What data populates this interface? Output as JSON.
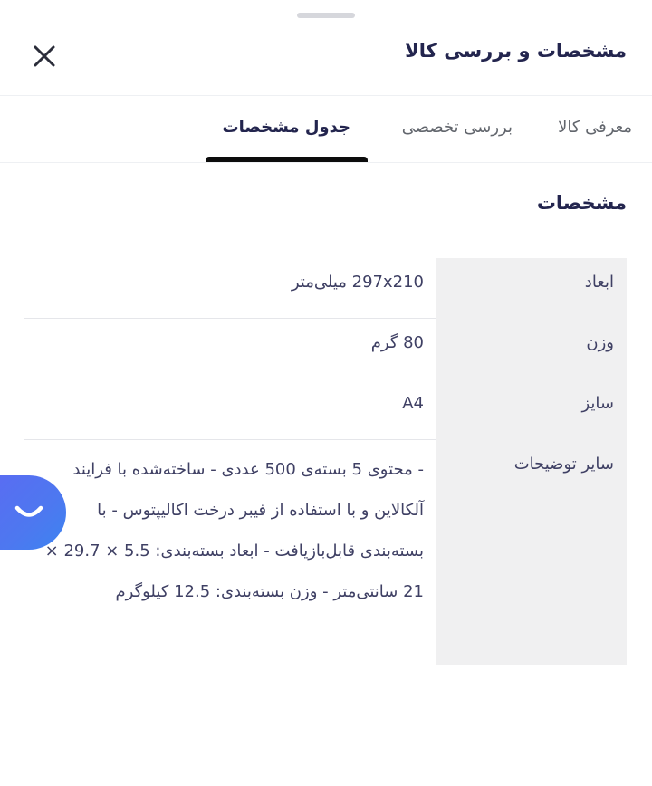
{
  "header": {
    "title": "مشخصات و بررسی کالا"
  },
  "tabs": [
    {
      "label": "معرفی کالا",
      "active": false
    },
    {
      "label": "بررسی تخصصی",
      "active": false
    },
    {
      "label": "جدول مشخصات",
      "active": true
    }
  ],
  "section": {
    "title": "مشخصات"
  },
  "specs": [
    {
      "key": "ابعاد",
      "value": "297x210 میلی‌متر"
    },
    {
      "key": "وزن",
      "value": "80 گرم"
    },
    {
      "key": "سایز",
      "value": "A4"
    },
    {
      "key": "سایر توضیحات",
      "value": "- محتوی 5 بسته‌ی 500 عددی - ساخته‌شده با فرایند آلکالاین و با استفاده از فیبر درخت اکالیپتوس - با بسته‌بندی قابل‌بازیافت - ابعاد بسته‌بندی: 5.5 × 29.7 × 21 سانتی‌متر - وزن بسته‌بندی: 12.5 کیلوگرم"
    }
  ],
  "colors": {
    "accent": "#5a6cf2",
    "tab_indicator": "#0c0c0c",
    "key_cell_bg": "#f0f0f1"
  }
}
